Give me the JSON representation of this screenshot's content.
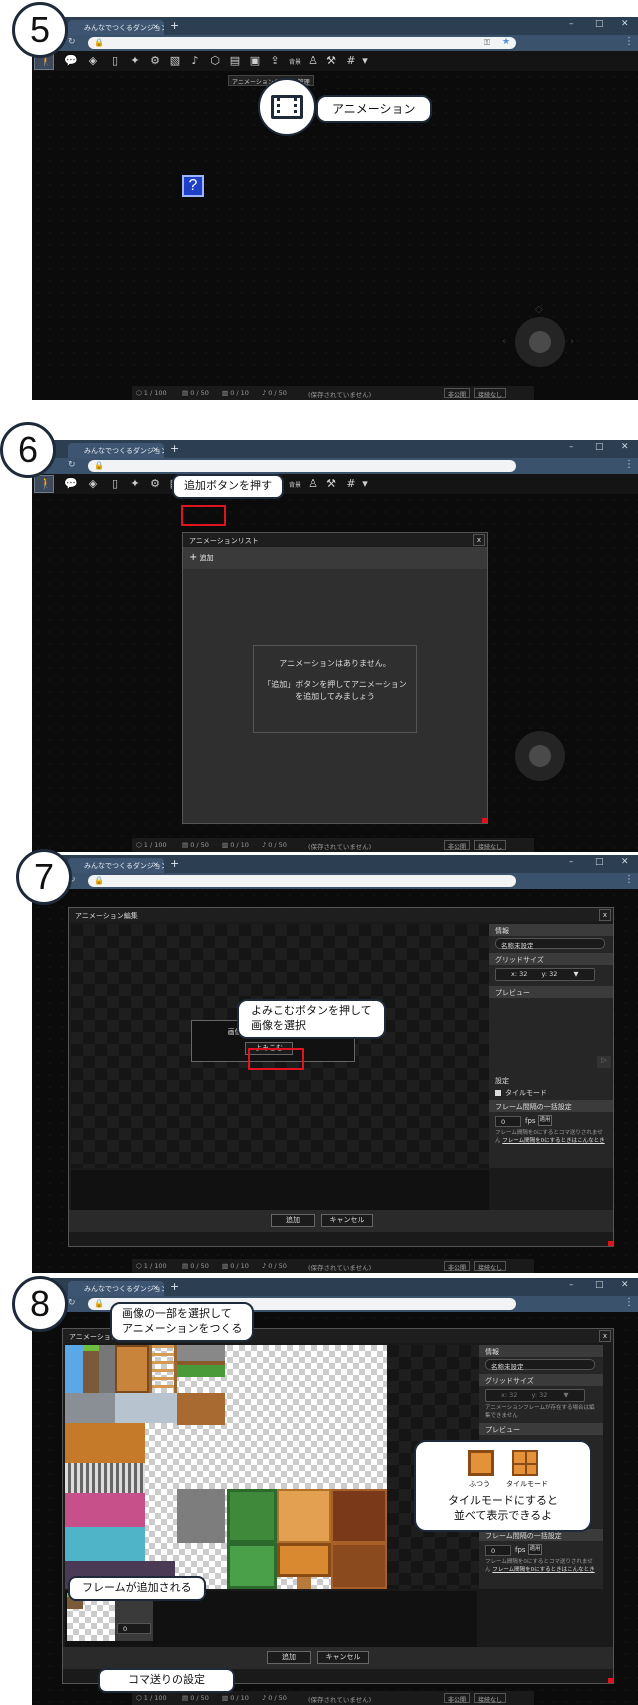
{
  "browser": {
    "tab_title": "みんなでつくるダンジョン",
    "tab_close": "×",
    "new_tab": "+",
    "win_min": "–",
    "win_max": "□",
    "win_close": "✕"
  },
  "toolbar": {
    "bgm_label": "背景",
    "tooltip": "アニメーションの作成と管理"
  },
  "status": {
    "sprites": "1 / 100",
    "frames": "0 / 50",
    "images": "0 / 10",
    "sounds": "0 / 50",
    "saved": "(保存されていません)",
    "publish": "非公開",
    "connect": "接続なし"
  },
  "steps": {
    "s5": {
      "badge": "5",
      "callout": "アニメーション",
      "question": "?"
    },
    "s6": {
      "badge": "6",
      "callout": "追加ボタンを押す",
      "dialog_title": "アニメーションリスト",
      "add_button": "追加",
      "empty_line1": "アニメーションはありません。",
      "empty_line2": "「追加」ボタンを押してアニメーション",
      "empty_line3": "を追加してみましょう"
    },
    "s7": {
      "badge": "7",
      "dialog_title": "アニメーション編集",
      "callout_line1": "よみこむボタンを押して",
      "callout_line2": "画像を選択",
      "prompt": "画像を読み込んでください。",
      "load_button": "よみこむ",
      "ok_button": "追加",
      "cancel_button": "キャンセル"
    },
    "s8": {
      "badge": "8",
      "callout_top_line1": "画像の一部を選択して",
      "callout_top_line2": "アニメーションをつくる",
      "callout_frame": "フレームが追加される",
      "callout_fps": "コマ送りの設定",
      "callout_tile_line1": "タイルモードにすると",
      "callout_tile_line2": "並べて表示できるよ",
      "tile_normal": "ふつう",
      "tile_mode": "タイルモード",
      "frame_label": "frame 0",
      "frame_value": "0",
      "frame_close": "x",
      "grid_note": "アニメーションフレームが存在する場合は編集できません",
      "ok_button": "追加",
      "cancel_button": "キャンセル"
    }
  },
  "panel": {
    "info": "情報",
    "name": "名称未設定",
    "grid_size": "グリッドサイズ",
    "grid_x": "x: 32",
    "grid_y": "y: 32",
    "grid_dropdown": "▼",
    "preview": "プレビュー",
    "settings": "設定",
    "tile_mode": "タイルモード",
    "frame_interval": "フレーム間隔の一括設定",
    "fps_value": "0",
    "fps_unit": "fps",
    "apply": "適用",
    "note_line1": "フレーム間隔を0にするとコマ送りされません",
    "note_link": "フレーム間隔を0にするときはこんなとき"
  },
  "colors": {
    "chrome_tabbar": "#2b3e52",
    "chrome_addr": "#3a526b",
    "canvas": "#0b0b0b",
    "highlight": "#e0141e",
    "question_block": "#1e3fc8",
    "badge_border": "#1e2a3a"
  }
}
